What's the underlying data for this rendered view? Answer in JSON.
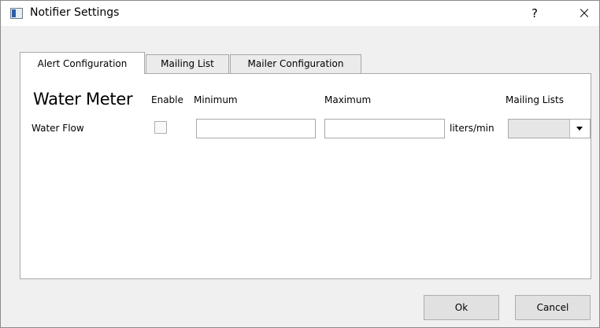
{
  "window": {
    "title": "Notifier Settings",
    "help_label": "?",
    "close_label": "×"
  },
  "tabs": [
    {
      "label": "Alert Configuration",
      "active": true
    },
    {
      "label": "Mailing List",
      "active": false
    },
    {
      "label": "Mailer Configuration",
      "active": false
    }
  ],
  "alert": {
    "section_title": "Water Meter",
    "columns": {
      "enable": "Enable",
      "minimum": "Minimum",
      "maximum": "Maximum",
      "mailing_lists": "Mailing Lists"
    },
    "rows": [
      {
        "label": "Water Flow",
        "enabled": false,
        "minimum": "",
        "maximum": "",
        "unit": "liters/min",
        "mailing_list": ""
      }
    ]
  },
  "buttons": {
    "ok": "Ok",
    "cancel": "Cancel"
  },
  "icons": {
    "app": "window-app-icon",
    "dropdown": "chevron-down-icon"
  }
}
